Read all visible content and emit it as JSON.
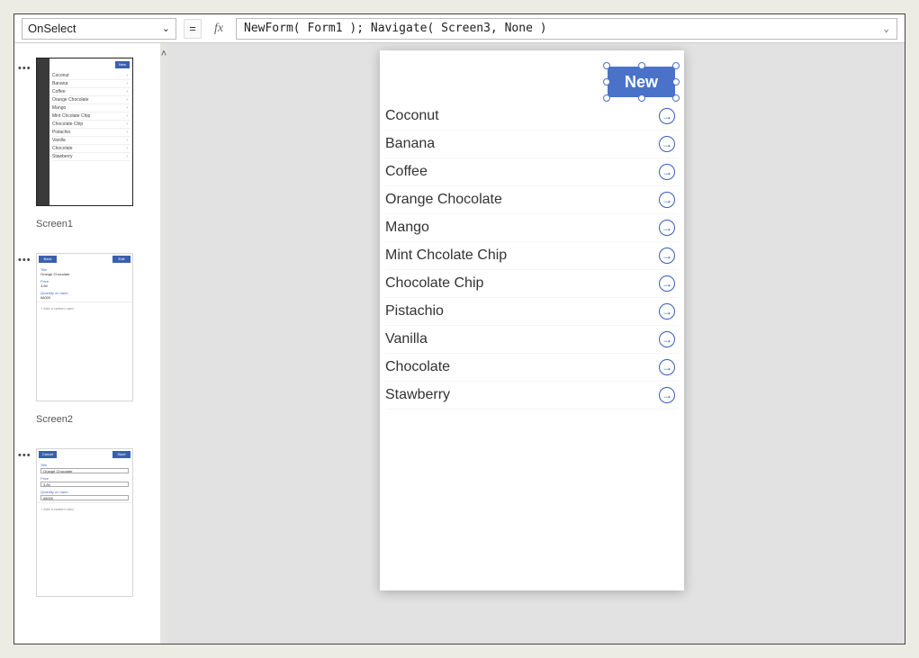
{
  "formula_bar": {
    "property": "OnSelect",
    "equals": "=",
    "fx": "fx",
    "expression": "NewForm( Form1 ); Navigate( Screen3, None )"
  },
  "screens": {
    "s1_label": "Screen1",
    "s2_label": "Screen2",
    "new_label": "New"
  },
  "thumb_items": [
    "Coconut",
    "Banana",
    "Coffee",
    "Orange Chocolate",
    "Mango",
    "Mint Chcolate Chip",
    "Chocolate Chip",
    "Pistachio",
    "Vanilla",
    "Chocolate",
    "Stawberry"
  ],
  "thumb2": {
    "back": "Back",
    "edit": "Edit",
    "title_lbl": "Title",
    "title_val": "Orange Chocolate",
    "price_lbl": "Price",
    "price_val": "3.89",
    "qty_lbl": "Quantity on hand",
    "qty_val": "68000",
    "add": "+  Add a custom card"
  },
  "thumb3": {
    "cancel": "Cancel",
    "save": "Save",
    "title_lbl": "Title",
    "title_val": "Orange Chocolate",
    "price_lbl": "Price",
    "price_val": "3.89",
    "qty_lbl": "Quantity on hand",
    "qty_val": "68000",
    "add": "+  Add a custom card"
  },
  "canvas": {
    "new_button": "New",
    "items": [
      "Coconut",
      "Banana",
      "Coffee",
      "Orange Chocolate",
      "Mango",
      "Mint Chcolate Chip",
      "Chocolate Chip",
      "Pistachio",
      "Vanilla",
      "Chocolate",
      "Stawberry"
    ]
  }
}
